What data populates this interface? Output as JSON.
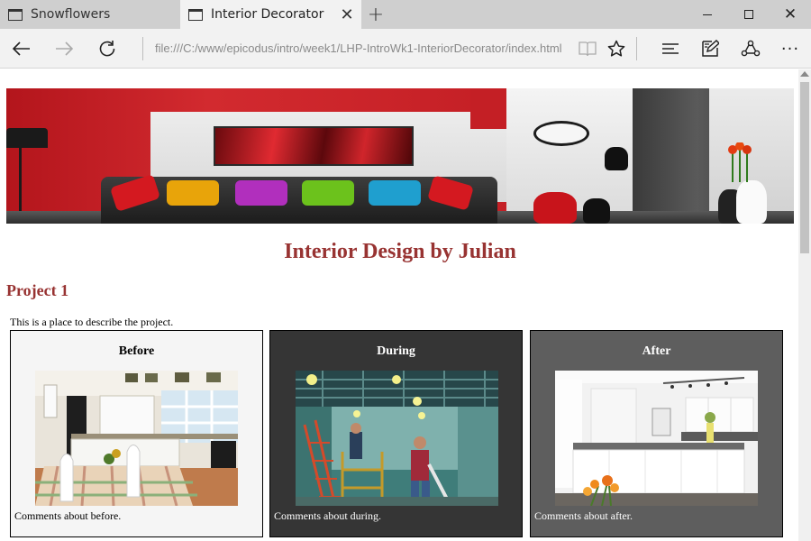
{
  "browser": {
    "tabs": [
      {
        "title": "Snowflowers",
        "active": false
      },
      {
        "title": "Interior Decorator",
        "active": true
      }
    ],
    "url": "file:///C:/www/epicodus/intro/week1/LHP-IntroWk1-InteriorDecorator/index.html",
    "icons": {
      "back": "back-arrow-icon",
      "forward": "forward-arrow-icon",
      "refresh": "refresh-icon",
      "reading_view": "book-icon",
      "favorite": "star-icon",
      "hub": "hub-icon",
      "note": "web-note-icon",
      "share": "share-icon",
      "more": "more-icon"
    }
  },
  "page": {
    "title": "Interior Design by Julian",
    "project": {
      "heading": "Project 1",
      "description": "This is a place to describe the project.",
      "panels": [
        {
          "heading": "Before",
          "comment": "Comments about before."
        },
        {
          "heading": "During",
          "comment": "Comments about during."
        },
        {
          "heading": "After",
          "comment": "Comments about after."
        }
      ]
    }
  },
  "colors": {
    "heading": "#983332",
    "before_bg": "#f5f5f5",
    "during_bg": "#353535",
    "after_bg": "#5e5e5e"
  }
}
